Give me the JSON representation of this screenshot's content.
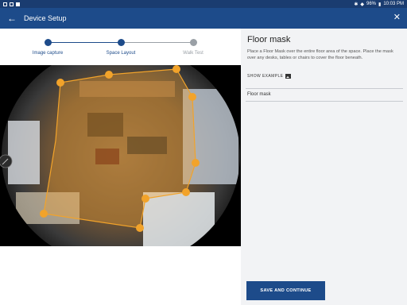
{
  "status_bar": {
    "battery": "96%",
    "time": "10:03 PM"
  },
  "app_bar": {
    "title": "Device Setup",
    "back_icon": "arrow-left-icon",
    "close_icon": "close-icon"
  },
  "stepper": {
    "steps": [
      {
        "label": "Image capture",
        "state": "complete"
      },
      {
        "label": "Space Layout",
        "state": "active"
      },
      {
        "label": "Walk Test",
        "state": "pending"
      }
    ]
  },
  "panel": {
    "title": "Floor mask",
    "description": "Place a Floor Mask over the entire floor area of the space. Place the mask over any desks, tables or chairs to cover the floor beneath.",
    "show_example": "SHOW EXAMPLE",
    "mask_item": "Floor mask",
    "save_button": "SAVE AND CONTINUE"
  },
  "colors": {
    "primary": "#1d4b8a",
    "mask_fill": "#f0a030",
    "handle": "#f2a32a",
    "step_active": "#1d4b8a",
    "step_pending": "#9aa0a6"
  }
}
